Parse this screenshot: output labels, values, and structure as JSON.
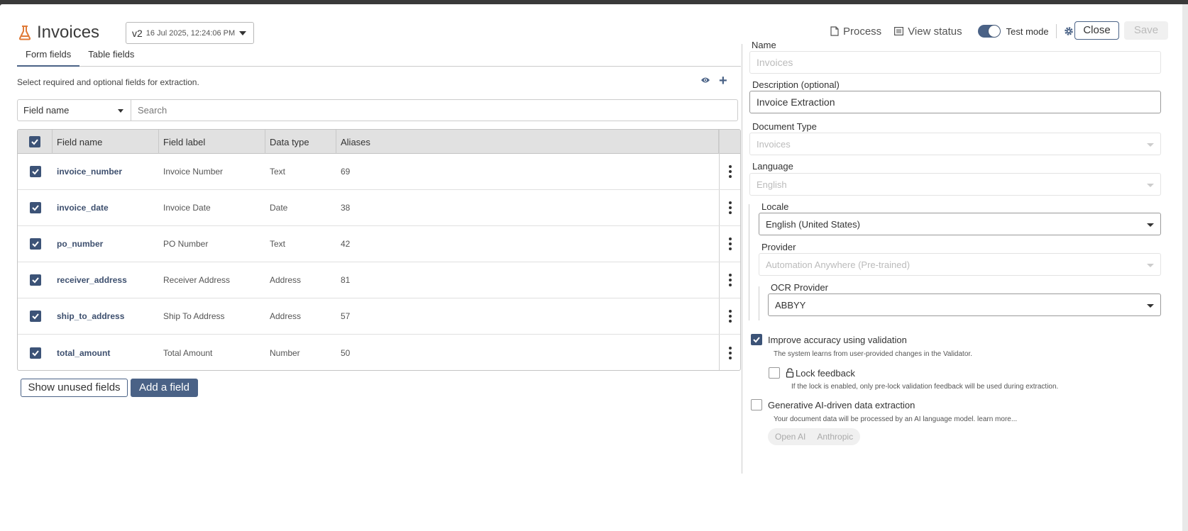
{
  "header": {
    "title": "Invoices",
    "version": "v2",
    "version_date": "16 Jul 2025, 12:24:06 PM",
    "process_label": "Process",
    "view_status_label": "View status",
    "test_mode_label": "Test mode",
    "test_mode_on": true,
    "close_label": "Close",
    "save_label": "Save"
  },
  "tabs": [
    {
      "label": "Form fields",
      "active": true
    },
    {
      "label": "Table fields",
      "active": false
    }
  ],
  "subtitle": "Select required and optional fields for extraction.",
  "filter": {
    "field_select": "Field name",
    "search_placeholder": "Search"
  },
  "table": {
    "columns": [
      "Field name",
      "Field label",
      "Data type",
      "Aliases"
    ],
    "rows": [
      {
        "name": "invoice_number",
        "label": "Invoice Number",
        "type": "Text",
        "aliases": "69",
        "checked": true
      },
      {
        "name": "invoice_date",
        "label": "Invoice Date",
        "type": "Date",
        "aliases": "38",
        "checked": true
      },
      {
        "name": "po_number",
        "label": "PO Number",
        "type": "Text",
        "aliases": "42",
        "checked": true
      },
      {
        "name": "receiver_address",
        "label": "Receiver Address",
        "type": "Address",
        "aliases": "81",
        "checked": true
      },
      {
        "name": "ship_to_address",
        "label": "Ship To Address",
        "type": "Address",
        "aliases": "57",
        "checked": true
      },
      {
        "name": "total_amount",
        "label": "Total Amount",
        "type": "Number",
        "aliases": "50",
        "checked": true
      }
    ]
  },
  "buttons": {
    "show_unused": "Show unused fields",
    "add_field": "Add a field"
  },
  "settings": {
    "name_label": "Name",
    "name_placeholder": "Invoices",
    "description_label": "Description (optional)",
    "description_value": "Invoice Extraction",
    "doc_type_label": "Document Type",
    "doc_type_value": "Invoices",
    "language_label": "Language",
    "language_value": "English",
    "locale_label": "Locale",
    "locale_value": "English (United States)",
    "provider_label": "Provider",
    "provider_value": "Automation Anywhere (Pre-trained)",
    "ocr_label": "OCR Provider",
    "ocr_value": "ABBYY",
    "improve_label": "Improve accuracy using validation",
    "improve_help": "The system learns from user-provided changes in the Validator.",
    "lock_label": "Lock feedback",
    "lock_help": "If the lock is enabled, only pre-lock validation feedback will be used during extraction.",
    "genai_label": "Generative AI-driven data extraction",
    "genai_help": "Your document data will be processed by an AI language model. learn more...",
    "genai_options": [
      "Open AI",
      "Anthropic"
    ]
  },
  "colors": {
    "accent": "#4a6286",
    "brand_icon": "#e07b39"
  }
}
